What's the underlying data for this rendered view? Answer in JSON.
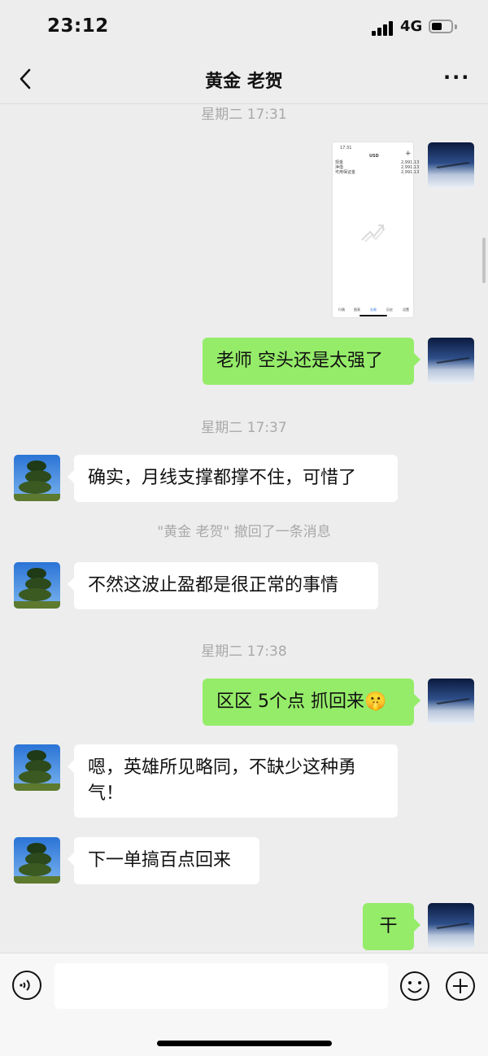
{
  "status": {
    "time": "23:12",
    "network": "4G",
    "battery_level": 0.45
  },
  "header": {
    "title": "黄金 老贺"
  },
  "messages": {
    "ts1": "星期二 17:31",
    "ts2": "星期二 17:37",
    "ts3": "星期二 17:38",
    "m_sent1": "老师 空头还是太强了",
    "m_recv1": "确实，月线支撑都撑不住，可惜了",
    "recall_notice": "\"黄金 老贺\" 撤回了一条消息",
    "m_recv2": "不然这波止盈都是很正常的事情",
    "m_sent2": "区区 5个点 抓回来",
    "m_sent2_emoji": "🤫",
    "m_recv3_line1": "嗯，英雄所见略同，不缺少这种勇",
    "m_recv3_line2": "气！",
    "m_recv4": "下一单搞百点回来",
    "m_sent3": "干"
  },
  "shared_image": {
    "time": "17:31",
    "symbol": "USD",
    "plus": "+",
    "rows": [
      {
        "label": "现金",
        "value": "2,991.13"
      },
      {
        "label": "净值",
        "value": "2,991.13"
      },
      {
        "label": "可用保证金",
        "value": "2,991.13"
      }
    ],
    "tabs": [
      "行情",
      "图表",
      "交易",
      "历史",
      "设置"
    ]
  },
  "colors": {
    "sent_bubble": "#95ec69",
    "received_bubble": "#ffffff",
    "background": "#ededed"
  }
}
